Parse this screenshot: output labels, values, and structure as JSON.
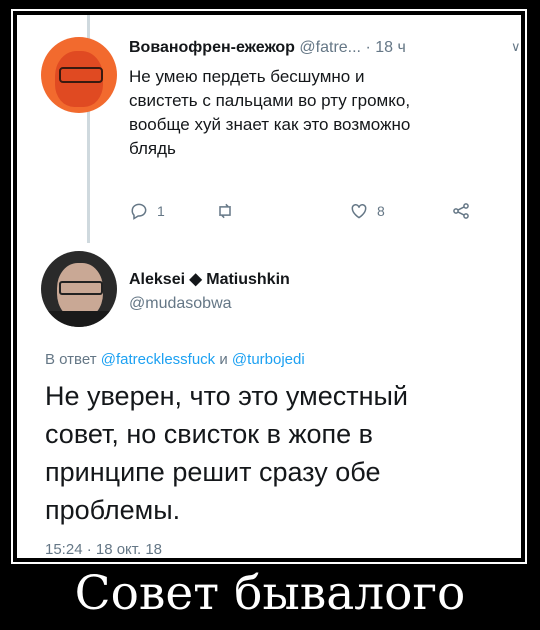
{
  "reply": {
    "name": "Вованофрен-ежежор",
    "handle": "@fatre...",
    "time_sep": " · 18 ч",
    "lines": [
      "Не умею пердеть бесшумно и",
      "свистеть с пальцами во рту громко,",
      "вообще хуй знает как это возможно",
      "блядь"
    ],
    "reply_count": "1",
    "like_count": "8"
  },
  "tweet": {
    "name": "Aleksei ◆ Matiushkin",
    "handle": "@mudasobwa",
    "reply_prefix": "В ответ",
    "reply_user1": "@fatrecklessfuck",
    "reply_and": "и",
    "reply_user2": "@turbojedi",
    "lines": [
      "Не уверен, что это уместный",
      "совет, но свисток в жопе в",
      "принципе решит сразу обе",
      "проблемы."
    ],
    "date": "15:24 · 18 окт. 18"
  },
  "caption": "Совет бывалого",
  "colors": {
    "link": "#1da1f2",
    "muted": "#657786",
    "text": "#14171a",
    "background": "#000000"
  }
}
